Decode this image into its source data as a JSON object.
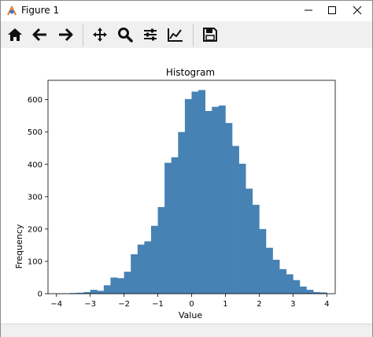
{
  "window": {
    "title": "Figure 1"
  },
  "toolbar": {
    "buttons": [
      {
        "name": "home-icon"
      },
      {
        "name": "back-arrow-icon"
      },
      {
        "name": "forward-arrow-icon"
      },
      {
        "name": "pan-move-icon"
      },
      {
        "name": "zoom-magnifier-icon"
      },
      {
        "name": "configure-subplots-icon"
      },
      {
        "name": "edit-axis-curve-icon"
      },
      {
        "name": "save-floppy-icon"
      }
    ]
  },
  "chart_data": {
    "type": "bar",
    "title": "Histogram",
    "xlabel": "Value",
    "ylabel": "Frequency",
    "xlim": [
      -4.25,
      4.25
    ],
    "ylim": [
      0,
      660
    ],
    "xticks": [
      -4,
      -3,
      -2,
      -1,
      0,
      1,
      2,
      3,
      4
    ],
    "xtick_labels": [
      "−4",
      "−3",
      "−2",
      "−1",
      "0",
      "1",
      "2",
      "3",
      "4"
    ],
    "yticks": [
      0,
      100,
      200,
      300,
      400,
      500,
      600
    ],
    "ytick_labels": [
      "0",
      "100",
      "200",
      "300",
      "400",
      "500",
      "600"
    ],
    "bar_color": "#4682b4",
    "bin_edges": [
      -4.0,
      -3.8,
      -3.6,
      -3.4,
      -3.2,
      -3.0,
      -2.8,
      -2.6,
      -2.4,
      -2.2,
      -2.0,
      -1.8,
      -1.6,
      -1.4,
      -1.2,
      -1.0,
      -0.8,
      -0.6,
      -0.4,
      -0.2,
      0.0,
      0.2,
      0.4,
      0.6,
      0.8,
      1.0,
      1.2,
      1.4,
      1.6,
      1.8,
      2.0,
      2.2,
      2.4,
      2.6,
      2.8,
      3.0,
      3.2,
      3.4,
      3.6,
      3.8,
      4.0
    ],
    "values": [
      1,
      1,
      2,
      3,
      5,
      12,
      9,
      26,
      50,
      48,
      68,
      122,
      152,
      162,
      210,
      268,
      405,
      422,
      500,
      602,
      625,
      630,
      565,
      578,
      582,
      528,
      457,
      402,
      325,
      275,
      200,
      142,
      105,
      76,
      60,
      42,
      22,
      12,
      5,
      4
    ]
  }
}
